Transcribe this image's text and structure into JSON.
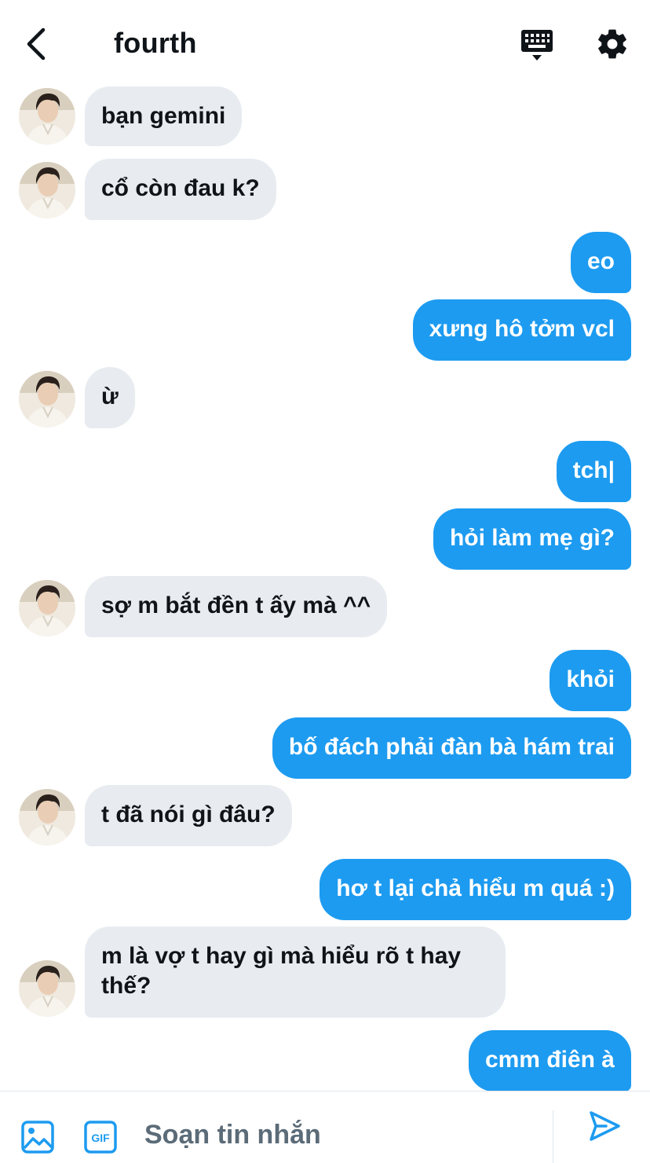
{
  "header": {
    "title": "fourth",
    "back_icon": "chevron-left-icon",
    "keyboard_icon": "keyboard-icon",
    "settings_icon": "gear-icon"
  },
  "colors": {
    "accent": "#1d9bf0",
    "incoming_bubble": "#e8ecf0",
    "text": "#0f1419",
    "muted": "#5b6b78"
  },
  "messages": [
    {
      "from": "them",
      "text": "bạn gemini"
    },
    {
      "from": "them",
      "text": "cổ còn đau k?"
    },
    {
      "from": "me",
      "text": "eo"
    },
    {
      "from": "me",
      "text": "xưng hô tởm vcl"
    },
    {
      "from": "them",
      "text": "ừ"
    },
    {
      "from": "me",
      "text": "tch|"
    },
    {
      "from": "me",
      "text": "hỏi làm mẹ gì?"
    },
    {
      "from": "them",
      "text": "sợ m bắt đền t ấy mà ^^"
    },
    {
      "from": "me",
      "text": "khỏi"
    },
    {
      "from": "me",
      "text": "bố đách phải đàn bà hám trai"
    },
    {
      "from": "them",
      "text": "t đã nói gì đâu?"
    },
    {
      "from": "me",
      "text": "hơ t lại chả hiểu m quá :)"
    },
    {
      "from": "them",
      "text": "m là vợ t hay gì mà hiểu rõ t hay\nthế?"
    },
    {
      "from": "me",
      "text": "cmm điên à"
    }
  ],
  "composer": {
    "placeholder": "Soạn tin nhắn",
    "gif_label": "GIF",
    "media_icon": "image-icon",
    "send_icon": "send-icon"
  }
}
